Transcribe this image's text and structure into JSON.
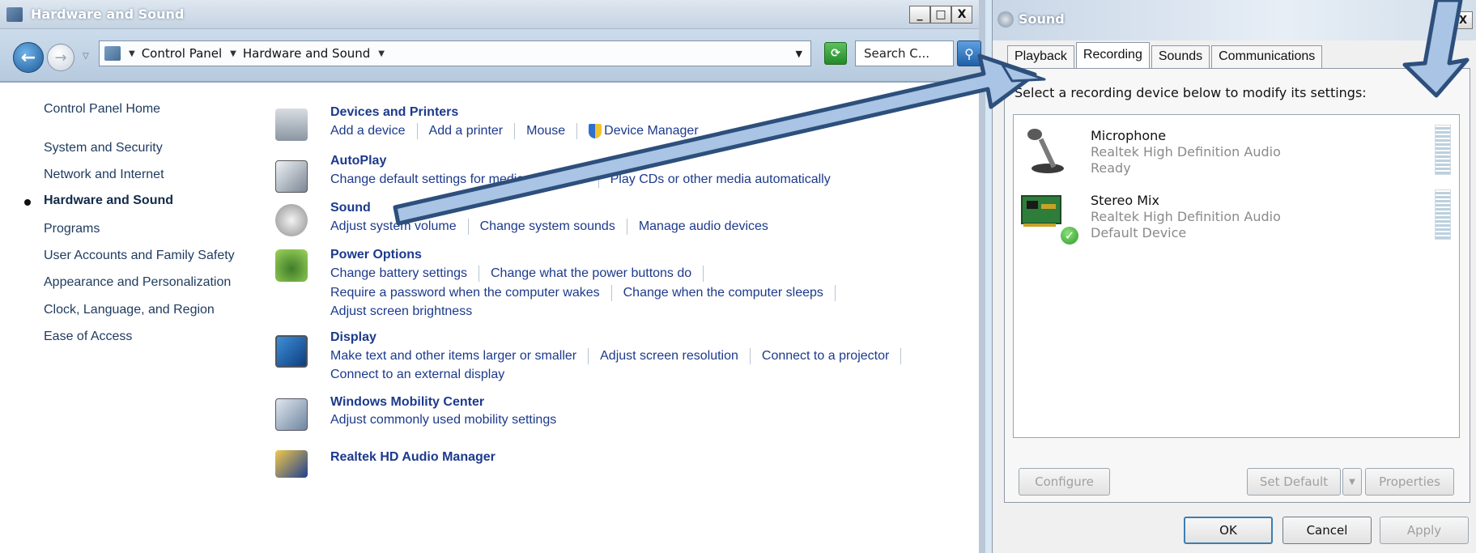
{
  "control_panel": {
    "window_title": "Hardware and Sound",
    "window_buttons": {
      "minimize": "_",
      "maximize": "□",
      "close": "X"
    },
    "breadcrumb": [
      "Control Panel",
      "Hardware and Sound"
    ],
    "search_placeholder": "Search C...",
    "left_nav": [
      {
        "label": "Control Panel Home"
      },
      {
        "label": "System and Security"
      },
      {
        "label": "Network and Internet"
      },
      {
        "label": "Hardware and Sound",
        "current": true
      },
      {
        "label": "Programs"
      },
      {
        "label": "User Accounts and Family Safety"
      },
      {
        "label": "Appearance and Personalization"
      },
      {
        "label": "Clock, Language, and Region"
      },
      {
        "label": "Ease of Access"
      }
    ],
    "categories": [
      {
        "title": "Devices and Printers",
        "icon": "printer-icon",
        "rows": [
          [
            "Add a device",
            "Add a printer",
            "Mouse",
            "Device Manager"
          ]
        ]
      },
      {
        "title": "AutoPlay",
        "icon": "autoplay-icon",
        "rows": [
          [
            "Change default settings for media or devices",
            "Play CDs or other media automatically"
          ]
        ]
      },
      {
        "title": "Sound",
        "icon": "speaker-icon",
        "rows": [
          [
            "Adjust system volume",
            "Change system sounds",
            "Manage audio devices"
          ]
        ]
      },
      {
        "title": "Power Options",
        "icon": "battery-icon",
        "rows": [
          [
            "Change battery settings",
            "Change what the power buttons do"
          ],
          [
            "Require a password when the computer wakes",
            "Change when the computer sleeps"
          ],
          [
            "Adjust screen brightness"
          ]
        ]
      },
      {
        "title": "Display",
        "icon": "monitor-icon",
        "rows": [
          [
            "Make text and other items larger or smaller",
            "Adjust screen resolution",
            "Connect to a projector"
          ],
          [
            "Connect to an external display"
          ]
        ]
      },
      {
        "title": "Windows Mobility Center",
        "icon": "mobility-icon",
        "rows": [
          [
            "Adjust commonly used mobility settings"
          ]
        ]
      },
      {
        "title": "Realtek HD Audio Manager",
        "icon": "audio-manager-icon",
        "rows": []
      }
    ]
  },
  "sound_dialog": {
    "title": "Sound",
    "close": "X",
    "tabs": [
      "Playback",
      "Recording",
      "Sounds",
      "Communications"
    ],
    "active_tab": "Recording",
    "instruction": "Select a recording device below to modify its settings:",
    "devices": [
      {
        "name": "Microphone",
        "driver": "Realtek High Definition Audio",
        "status": "Ready",
        "icon": "microphone-icon"
      },
      {
        "name": "Stereo Mix",
        "driver": "Realtek High Definition Audio",
        "status": "Default Device",
        "icon": "sound-card-icon"
      }
    ],
    "buttons": {
      "configure": "Configure",
      "set_default": "Set Default",
      "properties": "Properties",
      "ok": "OK",
      "cancel": "Cancel",
      "apply": "Apply"
    }
  },
  "colors": {
    "annotation_arrow_fill": "#a9c4e4",
    "annotation_arrow_stroke": "#2d4f7c",
    "link": "#1c3a8c"
  }
}
